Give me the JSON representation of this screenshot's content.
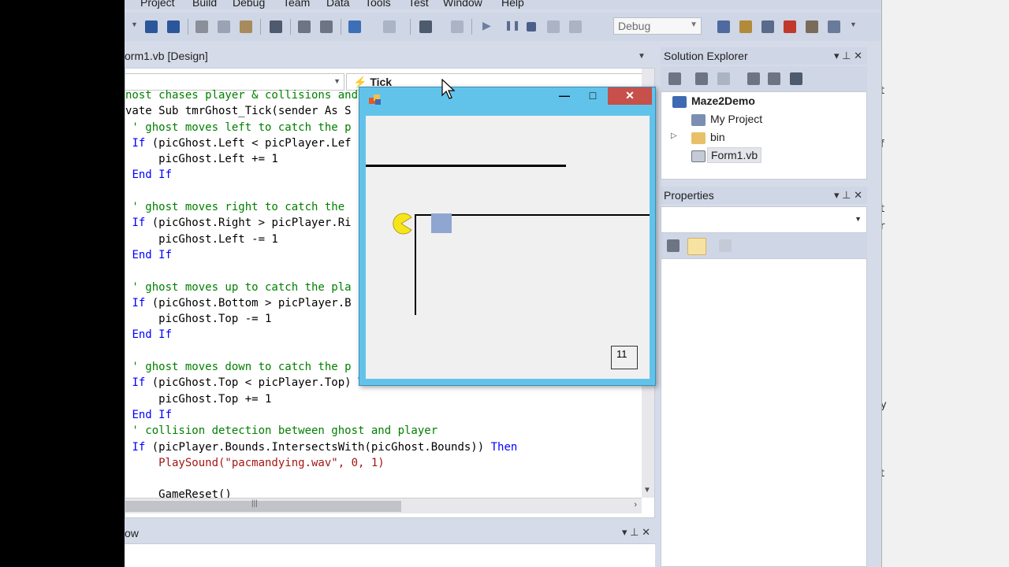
{
  "menu": [
    "Project",
    "Build",
    "Debug",
    "Team",
    "Data",
    "Tools",
    "Test",
    "Window",
    "Help"
  ],
  "toolbar": {
    "config_value": "Debug"
  },
  "editor": {
    "tab_title": "orm1.vb [Design]",
    "event_combo": "Tick",
    "code_lines": [
      [
        "cm",
        "nost chases player & collisions and"
      ],
      [
        "",
        "vate Sub tmrGhost_Tick(sender As S"
      ],
      [
        "cm",
        " ' ghost moves left to catch the p"
      ],
      [
        "kw",
        " If (picGhost.Left < picPlayer.Lef"
      ],
      [
        "",
        "     picGhost.Left += 1"
      ],
      [
        "kw",
        " End If"
      ],
      [
        "",
        ""
      ],
      [
        "cm",
        " ' ghost moves right to catch the"
      ],
      [
        "kw",
        " If (picGhost.Right > picPlayer.Ri"
      ],
      [
        "",
        "     picGhost.Left -= 1"
      ],
      [
        "kw",
        " End If"
      ],
      [
        "",
        ""
      ],
      [
        "cm",
        " ' ghost moves up to catch the pla"
      ],
      [
        "kw",
        " If (picGhost.Bottom > picPlayer.B"
      ],
      [
        "",
        "     picGhost.Top -= 1"
      ],
      [
        "kw",
        " End If"
      ],
      [
        "",
        ""
      ],
      [
        "cm",
        " ' ghost moves down to catch the p"
      ],
      [
        "kw",
        " If (picGhost.Top < picPlayer.Top) Then"
      ],
      [
        "",
        "     picGhost.Top += 1"
      ],
      [
        "kw",
        " End If"
      ],
      [
        "cm",
        " ' collision detection between ghost and player"
      ],
      [
        "kw",
        " If (picPlayer.Bounds.IntersectsWith(picGhost.Bounds)) Then"
      ],
      [
        "st",
        "     PlaySound(\"pacmandying.wav\", 0, 1)"
      ],
      [
        "",
        ""
      ],
      [
        "",
        "     GameReset()"
      ]
    ]
  },
  "output_panel": {
    "title": "ow"
  },
  "solution_explorer": {
    "title": "Solution Explorer",
    "items": [
      {
        "label": "Maze2Demo",
        "bold": true
      },
      {
        "label": "My Project"
      },
      {
        "label": "bin"
      },
      {
        "label": "Form1.vb"
      }
    ]
  },
  "properties": {
    "title": "Properties"
  },
  "form": {
    "score": "11",
    "close_label": "✕",
    "max_label": "□",
    "min_label": "—"
  },
  "right_window": {
    "chars": [
      "t",
      "r",
      "f",
      "t",
      "r",
      "y",
      "t"
    ]
  }
}
